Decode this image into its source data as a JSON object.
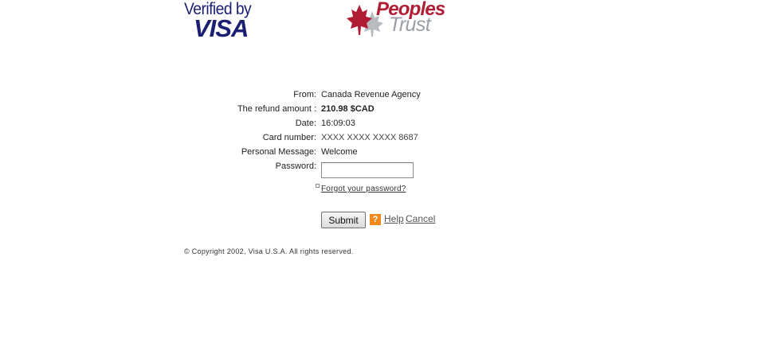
{
  "logos": {
    "visa_line1": "Verified by",
    "visa_line2": "VISA",
    "bank_line1": "Peoples",
    "bank_line2": "Trust",
    "brand_colors": {
      "visa_blue": "#1a1f71",
      "bank_red": "#b01c34",
      "bank_gray": "#9a9fa5"
    }
  },
  "form": {
    "from_label": "From:",
    "from_value": "Canada Revenue Agency",
    "refund_label": "The refund amount :",
    "refund_value": "210.98 $CAD",
    "date_label": "Date:",
    "date_value": "16:09:03",
    "card_label": "Card number:",
    "card_value": "XXXX XXXX XXXX 8687",
    "message_label": "Personal Message:",
    "message_value": "Welcome",
    "password_label": "Password:",
    "password_value": "",
    "forgot_link": "Forgot your password?"
  },
  "actions": {
    "submit_label": "Submit",
    "help_icon_glyph": "?",
    "help_label": "Help",
    "cancel_label": "Cancel",
    "help_icon_color": "#f08a1c"
  },
  "footer": {
    "copyright": "© Copyright 2002, Visa U.S.A. All rights reserved."
  }
}
